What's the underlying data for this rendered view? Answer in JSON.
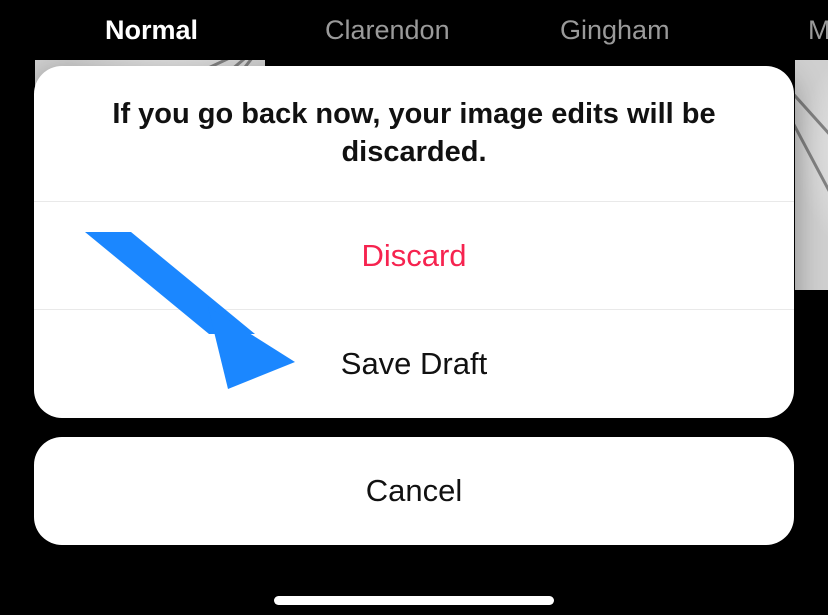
{
  "filters": {
    "normal": "Normal",
    "clarendon": "Clarendon",
    "gingham": "Gingham",
    "cut": "M"
  },
  "sheet": {
    "title": "If you go back now, your image edits will be discarded.",
    "discard": "Discard",
    "save_draft": "Save Draft",
    "cancel": "Cancel"
  },
  "annotation": {
    "arrow_color": "#1b87ff"
  }
}
